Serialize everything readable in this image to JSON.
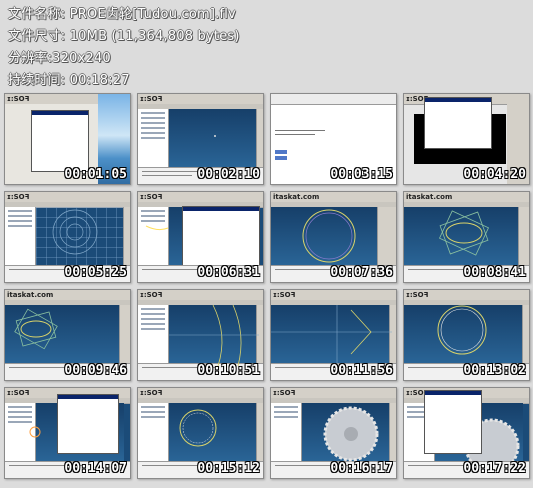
{
  "file_info": {
    "filename": "文件名称: PROE齿轮[Tudou.com].flv",
    "filesize": "文件尺寸: 10MB (11,364,808 bytes)",
    "resolution": "分辨率:320x240",
    "duration": "持续时间: 00:18:27"
  },
  "thumbnails": [
    {
      "time": "00:01:05",
      "logo": "ɪ:SOꟻ"
    },
    {
      "time": "00:02:10",
      "logo": "ɪ:SOꟻ"
    },
    {
      "time": "00:03:15",
      "logo": ""
    },
    {
      "time": "00:04:20",
      "logo": "ɪ:SOꟻ"
    },
    {
      "time": "00:05:25",
      "logo": "ɪ:SOꟻ"
    },
    {
      "time": "00:06:31",
      "logo": "ɪ:SOꟻ"
    },
    {
      "time": "00:07:36",
      "logo": "itaskat.com"
    },
    {
      "time": "00:08:41",
      "logo": "itaskat.com"
    },
    {
      "time": "00:09:46",
      "logo": "itaskat.com"
    },
    {
      "time": "00:10:51",
      "logo": "ɪ:SOꟻ"
    },
    {
      "time": "00:11:56",
      "logo": "ɪ:SOꟻ"
    },
    {
      "time": "00:13:02",
      "logo": "ɪ:SOꟻ"
    },
    {
      "time": "00:14:07",
      "logo": "ɪ:SOꟻ"
    },
    {
      "time": "00:15:12",
      "logo": "ɪ:SOꟻ"
    },
    {
      "time": "00:16:17",
      "logo": "ɪ:SOꟻ"
    },
    {
      "time": "00:17:22",
      "logo": "ɪ:SOꟻ"
    }
  ]
}
